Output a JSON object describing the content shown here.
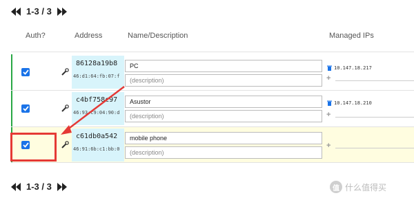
{
  "pager_top": {
    "label": "1-3 / 3"
  },
  "pager_bottom": {
    "label": "1-3 / 3"
  },
  "columns": {
    "auth": "Auth?",
    "address": "Address",
    "name": "Name/Description",
    "managed_ips": "Managed IPs"
  },
  "rows": [
    {
      "checked": true,
      "short_addr": "86128a19b8",
      "mac": "46:d1:64:fb:07:f",
      "name": "PC",
      "description_placeholder": "(description)",
      "ip": "10.147.18.217"
    },
    {
      "checked": true,
      "short_addr": "c4bf758c97",
      "mac": "46:93:c9:04:90:d",
      "name": "Asustor",
      "description_placeholder": "(description)",
      "ip": "10.147.18.210"
    },
    {
      "checked": true,
      "short_addr": "c61db0a542",
      "mac": "46:91:6b:c1:bb:0",
      "name": "mobile phone",
      "description_placeholder": "(description)",
      "ip": ""
    }
  ],
  "watermark": {
    "badge": "值",
    "text": "什么值得买"
  },
  "colors": {
    "accent_green": "#28a745",
    "highlight_row": "#fffde0",
    "address_bg": "#d8f4fb",
    "annotation_red": "#e53935",
    "checkbox_blue": "#1a73e8"
  }
}
